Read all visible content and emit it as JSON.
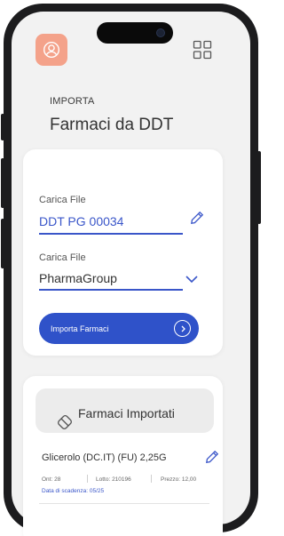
{
  "header": {
    "kicker": "IMPORTA",
    "title": "Farmaci da DDT"
  },
  "upload": {
    "file_label": "Carica File",
    "file_value": "DDT PG 00034",
    "supplier_label": "Carica File",
    "supplier_value": "PharmaGroup",
    "import_button": "Importa Farmaci"
  },
  "imported": {
    "title": "Farmaci Importati",
    "items": [
      {
        "name": "Glicerolo (DC.IT) (FU) 2,25G",
        "qty": "Ont: 28",
        "lot": "Lotto: 210196",
        "price": "Prezzo: 12,00",
        "expiry": "Data di scadenza: 05/25"
      }
    ]
  },
  "colors": {
    "accent": "#2f52c9",
    "avatar_bg": "#f4a28a",
    "screen_bg": "#f2f2f2"
  },
  "icons": [
    "user-icon",
    "grid-icon",
    "pencil-icon",
    "chevron-down-icon",
    "arrow-right-circle-icon",
    "pill-icon"
  ]
}
